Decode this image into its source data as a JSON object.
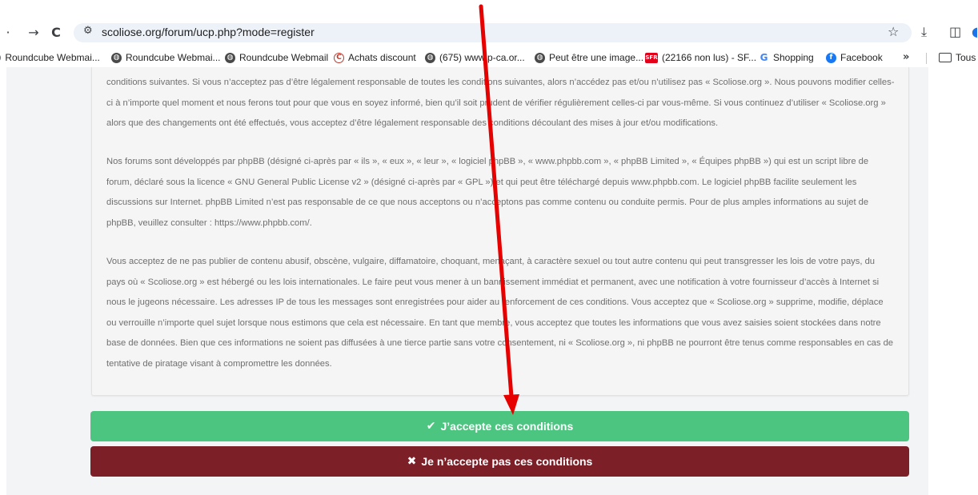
{
  "browser": {
    "url": "scoliose.org/forum/ucp.php?mode=register",
    "nav": {
      "back_icon": "·",
      "forward_icon": "→",
      "reload_icon": "C"
    }
  },
  "bookmarks": [
    {
      "label": "Roundcube Webmai...",
      "icon": "globe-icon"
    },
    {
      "label": "Roundcube Webmai...",
      "icon": "globe-icon"
    },
    {
      "label": "Roundcube Webmail",
      "icon": "globe-icon"
    },
    {
      "label": "Achats discount",
      "icon": "c-logo-icon"
    },
    {
      "label": "(675) www.p-ca.or...",
      "icon": "globe-icon"
    },
    {
      "label": "Peut être une image...",
      "icon": "globe-icon"
    },
    {
      "label": "(22166 non lus) - SF...",
      "icon": "sfr-icon"
    },
    {
      "label": "Shopping",
      "icon": "google-icon"
    },
    {
      "label": "Facebook",
      "icon": "facebook-icon"
    },
    {
      "label": "Tous",
      "icon": "folder-icon"
    }
  ],
  "bookmark_icons": {
    "sfr": "SFR",
    "google": "G",
    "facebook": "f",
    "more": "»"
  },
  "terms": {
    "p1": "conditions suivantes. Si vous n’acceptez pas d’être légalement responsable de toutes les conditions suivantes, alors n’accédez pas et/ou n’utilisez pas « Scoliose.org ». Nous pouvons modifier celles-ci à n’importe quel moment et nous ferons tout pour que vous en soyez informé, bien qu’il soit prudent de vérifier régulièrement celles-ci par vous-même. Si vous continuez d’utiliser « Scoliose.org » alors que des changements ont été effectués, vous acceptez d’être légalement responsable des conditions découlant des mises à jour et/ou modifications.",
    "p2": "Nos forums sont développés par phpBB (désigné ci-après par « ils », « eux », « leur », « logiciel phpBB », « www.phpbb.com », « phpBB Limited », « Équipes phpBB ») qui est un script libre de forum, déclaré sous la licence « GNU General Public License v2 » (désigné ci-après par « GPL ») et qui peut être téléchargé depuis www.phpbb.com. Le logiciel phpBB facilite seulement les discussions sur Internet. phpBB Limited n’est pas responsable de ce que nous acceptons ou n’acceptons pas comme contenu ou conduite permis. Pour de plus amples informations au sujet de phpBB, veuillez consulter : https://www.phpbb.com/.",
    "p3": "Vous acceptez de ne pas publier de contenu abusif, obscène, vulgaire, diffamatoire, choquant, menaçant, à caractère sexuel ou tout autre contenu qui peut transgresser les lois de votre pays, du pays où « Scoliose.org » est hébergé ou les lois internationales. Le faire peut vous mener à un bannissement immédiat et permanent, avec une notification à votre fournisseur d’accès à Internet si nous le jugeons nécessaire. Les adresses IP de tous les messages sont enregistrées pour aider au renforcement de ces conditions. Vous acceptez que « Scoliose.org » supprime, modifie, déplace ou verrouille n’importe quel sujet lorsque nous estimons que cela est nécessaire. En tant que membre, vous acceptez que toutes les informations que vous avez saisies soient stockées dans notre base de données. Bien que ces informations ne soient pas diffusées à une tierce partie sans votre consentement, ni « Scoliose.org », ni phpBB ne pourront être tenus comme responsables en cas de tentative de piratage visant à compromettre les données."
  },
  "buttons": {
    "accept_label": "J’accepte ces conditions",
    "accept_icon": "✔",
    "decline_label": "Je n’accepte pas ces conditions",
    "decline_icon": "✖"
  },
  "colors": {
    "accept": "#4bc57f",
    "decline": "#7c1f27",
    "annotation_arrow": "#e60000"
  }
}
